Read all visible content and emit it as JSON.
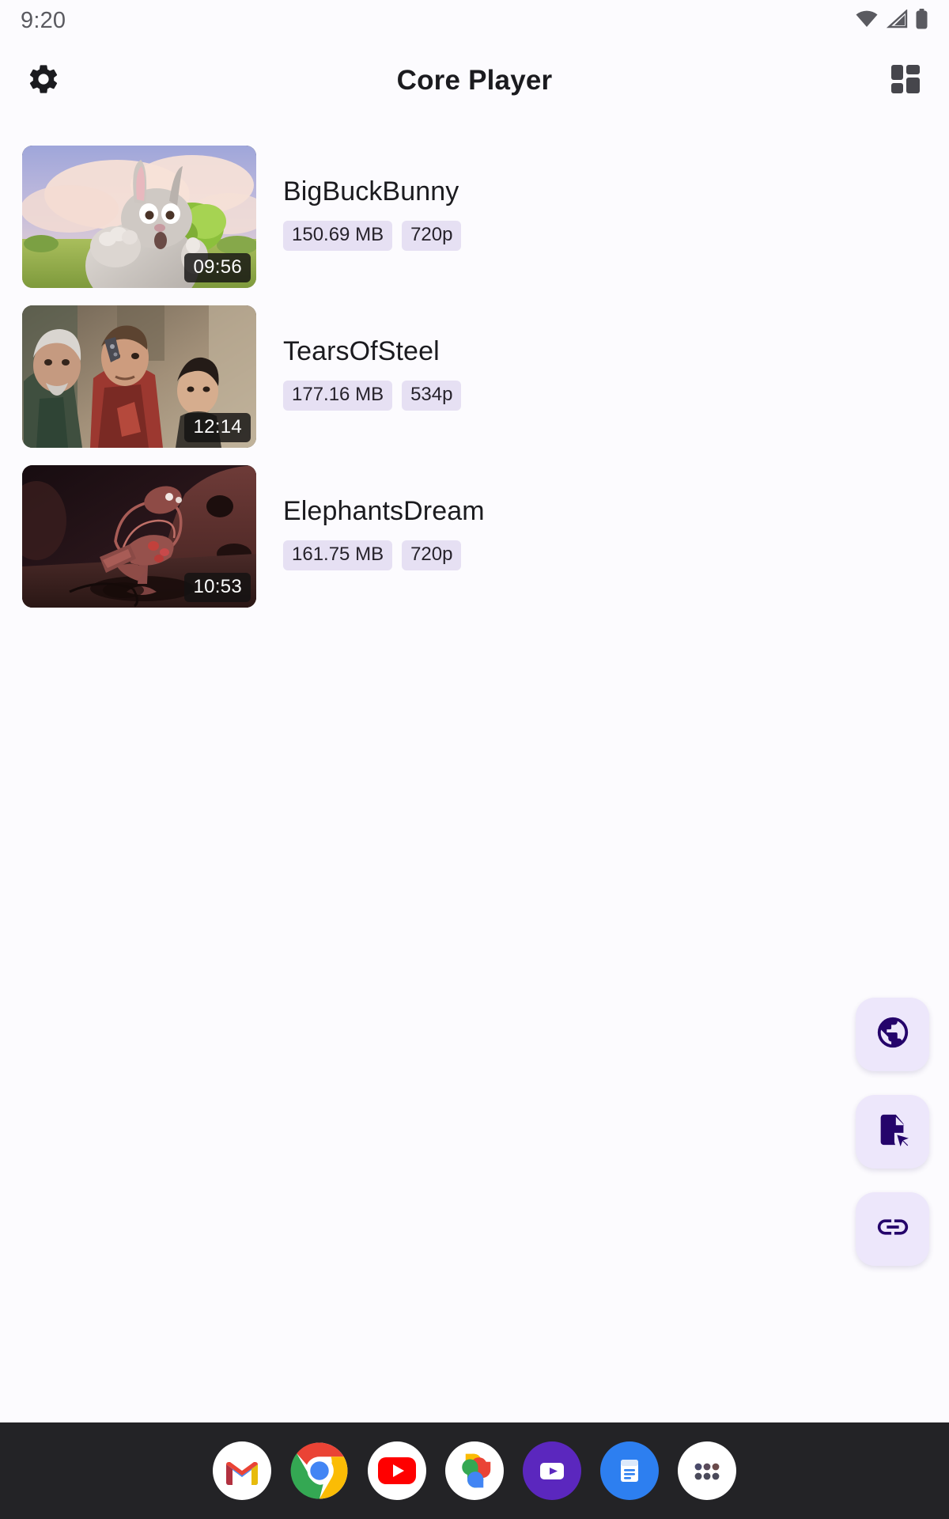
{
  "status_bar": {
    "time": "9:20",
    "icons": [
      "wifi-icon",
      "cellular-signal-icon",
      "battery-icon"
    ]
  },
  "app_bar": {
    "title": "Core Player",
    "left_icon": "gear-icon",
    "right_icon": "grid-view-icon"
  },
  "videos": [
    {
      "title": "BigBuckBunny",
      "size": "150.69 MB",
      "resolution": "720p",
      "duration": "09:56",
      "thumbnail": "bigbuckbunny-thumbnail"
    },
    {
      "title": "TearsOfSteel",
      "size": "177.16 MB",
      "resolution": "534p",
      "duration": "12:14",
      "thumbnail": "tearsofsteel-thumbnail"
    },
    {
      "title": "ElephantsDream",
      "size": "161.75 MB",
      "resolution": "720p",
      "duration": "10:53",
      "thumbnail": "elephantsdream-thumbnail"
    }
  ],
  "fabs": [
    {
      "icon": "globe-icon",
      "name": "open-network-stream-fab"
    },
    {
      "icon": "file-open-icon",
      "name": "open-file-fab"
    },
    {
      "icon": "link-icon",
      "name": "open-link-fab"
    }
  ],
  "dock": {
    "apps": [
      {
        "name": "gmail-app-icon",
        "label": "Gmail"
      },
      {
        "name": "chrome-app-icon",
        "label": "Chrome"
      },
      {
        "name": "youtube-app-icon",
        "label": "YouTube"
      },
      {
        "name": "google-photos-app-icon",
        "label": "Photos"
      },
      {
        "name": "video-player-app-icon",
        "label": "Player"
      },
      {
        "name": "docs-app-icon",
        "label": "Docs"
      },
      {
        "name": "app-drawer-icon",
        "label": "All apps"
      }
    ]
  },
  "colors": {
    "background": "#FCFBFE",
    "chip_background": "#E6E0F3",
    "fab_background": "#EDE7FB",
    "fab_icon": "#25046B",
    "dock_background": "#232326",
    "text_primary": "#1B1B1F"
  }
}
